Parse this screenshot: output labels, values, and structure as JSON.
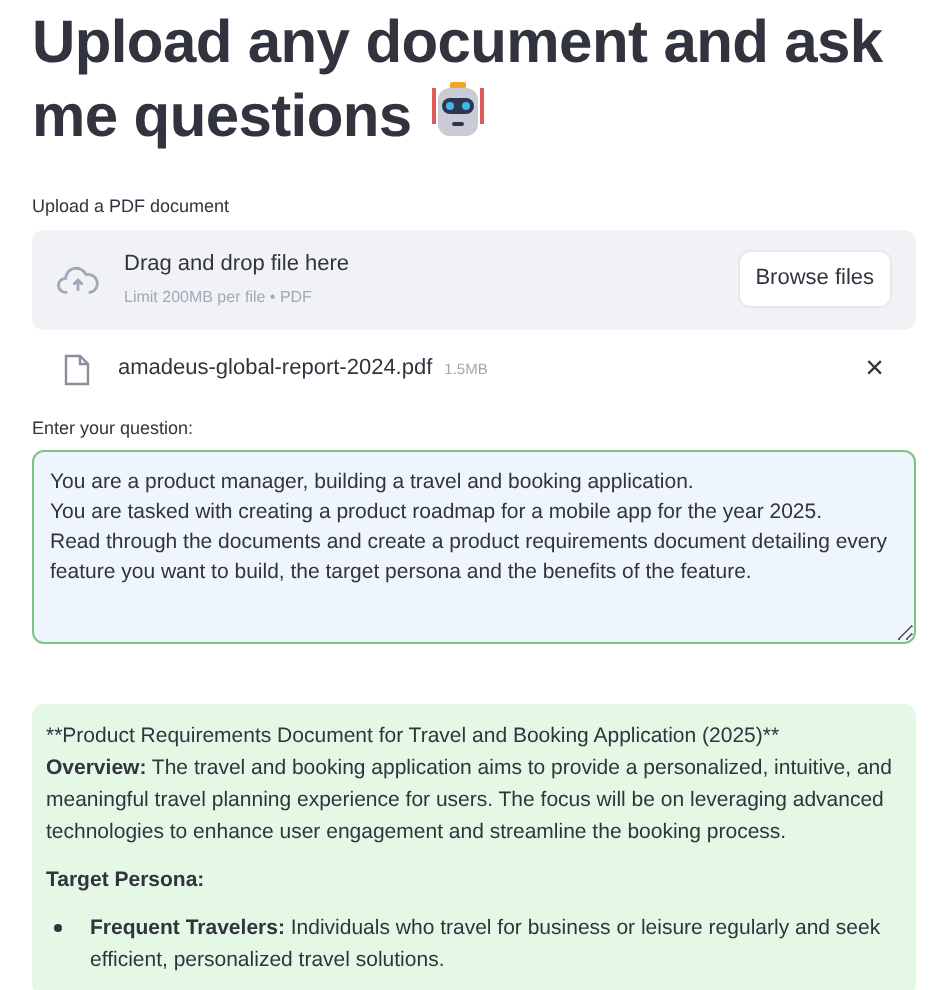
{
  "title": "Upload any document and ask me questions",
  "uploader": {
    "label": "Upload a PDF document",
    "drop_text": "Drag and drop file here",
    "limit": "Limit 200MB per file • PDF",
    "button": "Browse files"
  },
  "file": {
    "name": "amadeus-global-report-2024.pdf",
    "size": "1.5MB",
    "remove": "×"
  },
  "question": {
    "label": "Enter your question:",
    "value": "You are a product manager, building a travel and booking application.\nYou are tasked with creating a product roadmap for a mobile app for the year 2025.\nRead through the documents and create a product requirements document detailing every feature you want to build, the target persona and the benefits of the feature."
  },
  "answer": {
    "heading": "**Product Requirements Document for Travel and Booking Application (2025)**",
    "overview": "**Overview:** The travel and booking application aims to provide a personalized, intuitive, and meaningful travel planning experience for users. The focus will be on leveraging advanced technologies to enhance user engagement and streamline the booking process.",
    "section": "Target Persona:",
    "bullets": [
      "**Frequent Travelers:** Individuals who travel for business or leisure regularly and seek efficient, personalized travel solutions."
    ]
  }
}
